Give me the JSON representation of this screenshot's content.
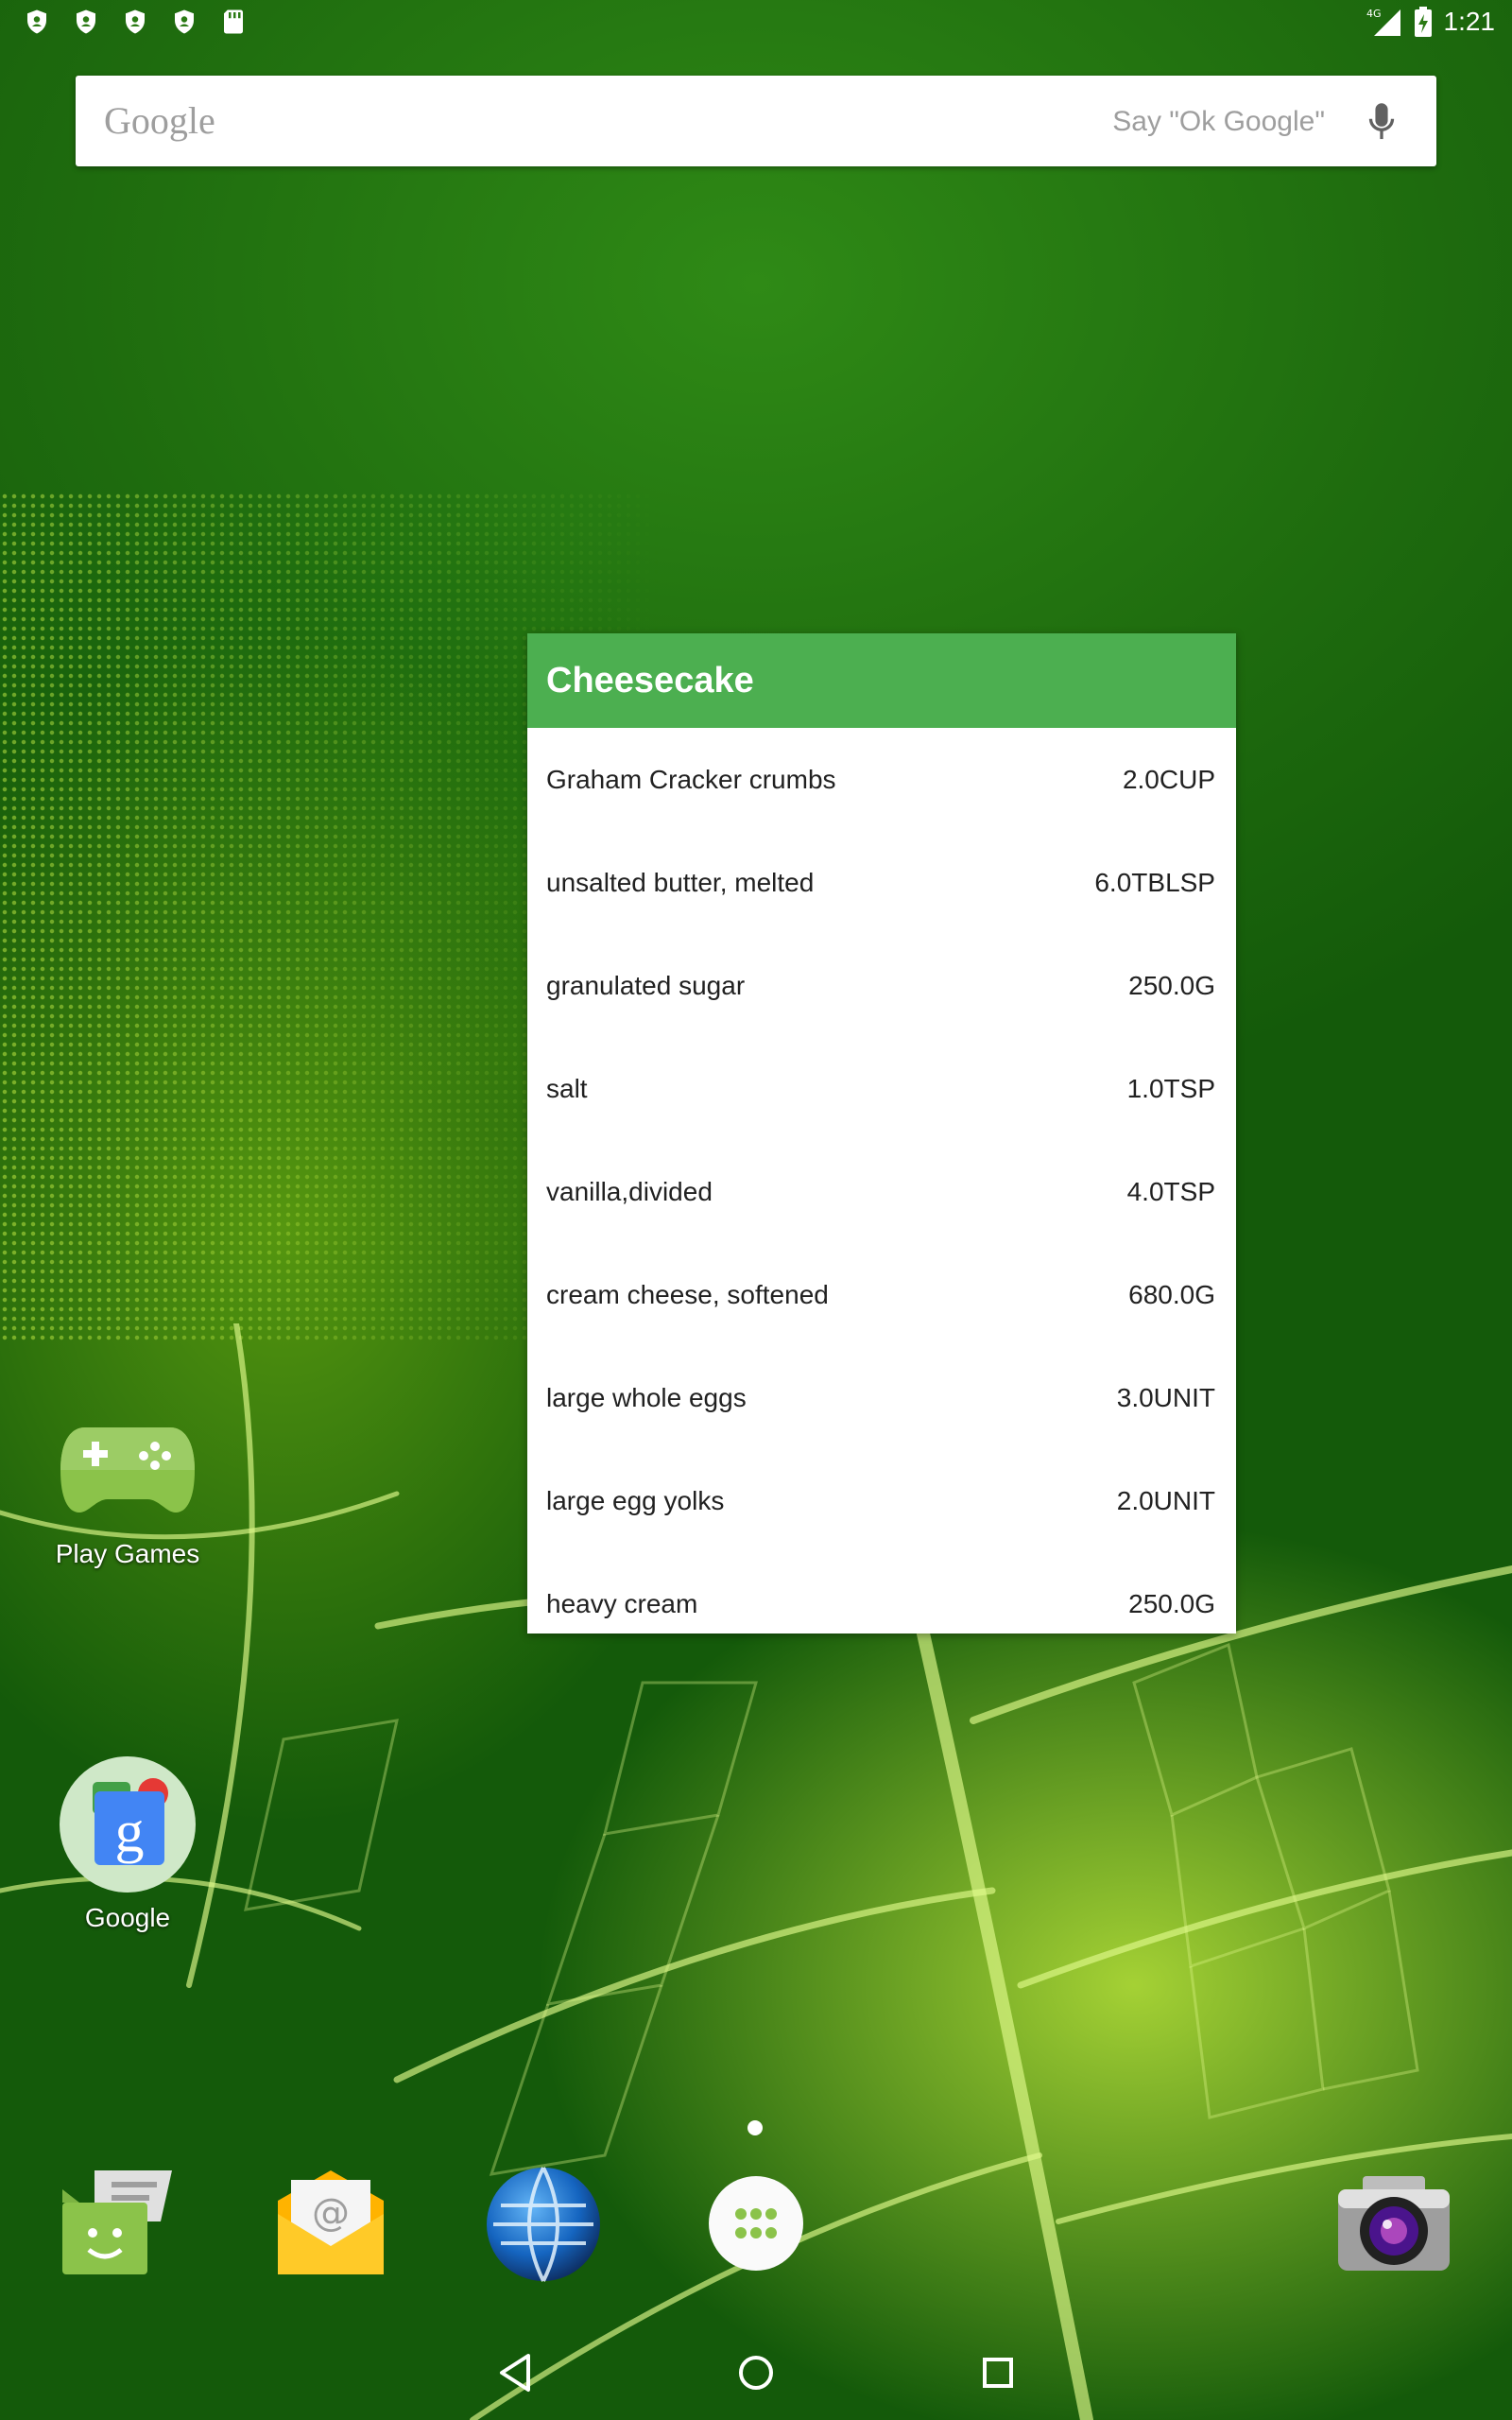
{
  "status_bar": {
    "time": "1:21",
    "network": "4G",
    "left_icons": [
      "shield-icon",
      "shield-icon",
      "shield-icon",
      "shield-icon",
      "sd-card-icon"
    ]
  },
  "search": {
    "logo": "Google",
    "hint": "Say \"Ok Google\""
  },
  "widget": {
    "title": "Cheesecake",
    "header_color": "#4caf50",
    "ingredients": [
      {
        "name": "Graham Cracker crumbs",
        "qty": "2.0CUP"
      },
      {
        "name": "unsalted butter, melted",
        "qty": "6.0TBLSP"
      },
      {
        "name": "granulated sugar",
        "qty": "250.0G"
      },
      {
        "name": "salt",
        "qty": "1.0TSP"
      },
      {
        "name": "vanilla,divided",
        "qty": "4.0TSP"
      },
      {
        "name": "cream cheese, softened",
        "qty": "680.0G"
      },
      {
        "name": "large whole eggs",
        "qty": "3.0UNIT"
      },
      {
        "name": "large egg yolks",
        "qty": "2.0UNIT"
      },
      {
        "name": "heavy cream",
        "qty": "250.0G"
      }
    ]
  },
  "desktop": {
    "apps": [
      {
        "label": "Play Games",
        "icon": "play-games-icon"
      },
      {
        "label": "Google",
        "icon": "google-app-icon"
      }
    ]
  },
  "dock": {
    "icons": [
      "messenger-icon",
      "email-icon",
      "browser-icon",
      "app-drawer-icon",
      "camera-icon"
    ]
  },
  "nav": {
    "buttons": [
      "back-icon",
      "home-icon",
      "recents-icon"
    ]
  }
}
